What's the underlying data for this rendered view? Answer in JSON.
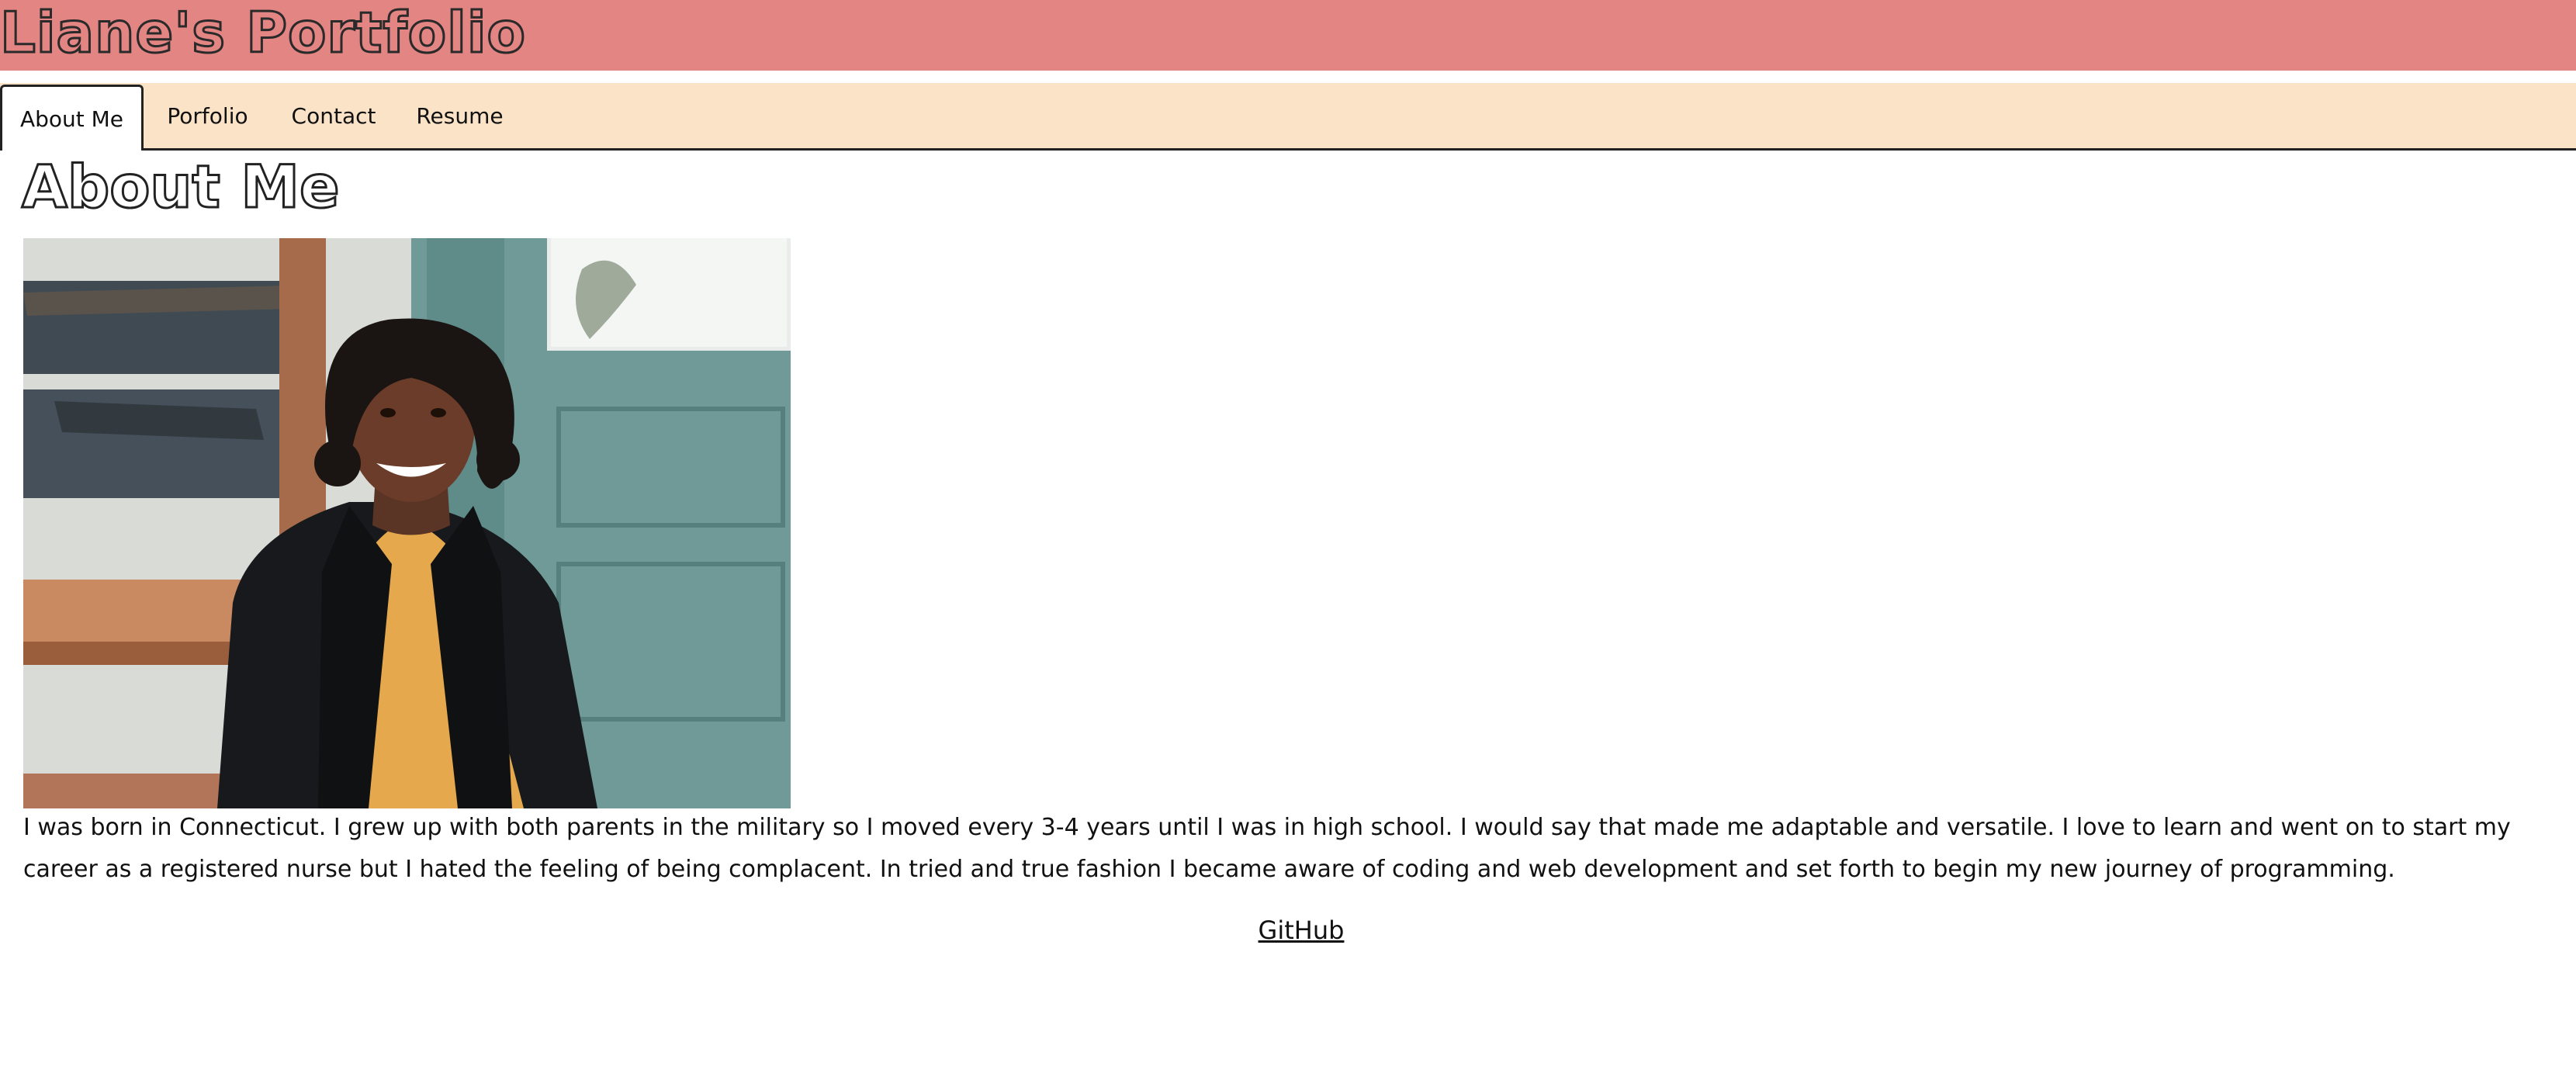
{
  "header": {
    "title": "Liane's Portfolio",
    "background_color": "#e38583"
  },
  "nav": {
    "background_color": "#fbe3c7",
    "tabs": [
      {
        "label": "About Me",
        "active": true
      },
      {
        "label": "Porfolio",
        "active": false
      },
      {
        "label": "Contact",
        "active": false
      },
      {
        "label": "Resume",
        "active": false
      }
    ]
  },
  "main": {
    "heading": "About Me",
    "bio": "I was born in Connecticut. I grew up with both parents in the military so I moved every 3-4 years until I was in high school. I would say that made me adaptable and versatile. I love to learn and went on to start my career as a registered nurse but I hated the feeling of being complacent. In tried and true fashion I became aware of coding and web development and set forth to begin my new journey of programming.",
    "github_link": "GitHub"
  }
}
